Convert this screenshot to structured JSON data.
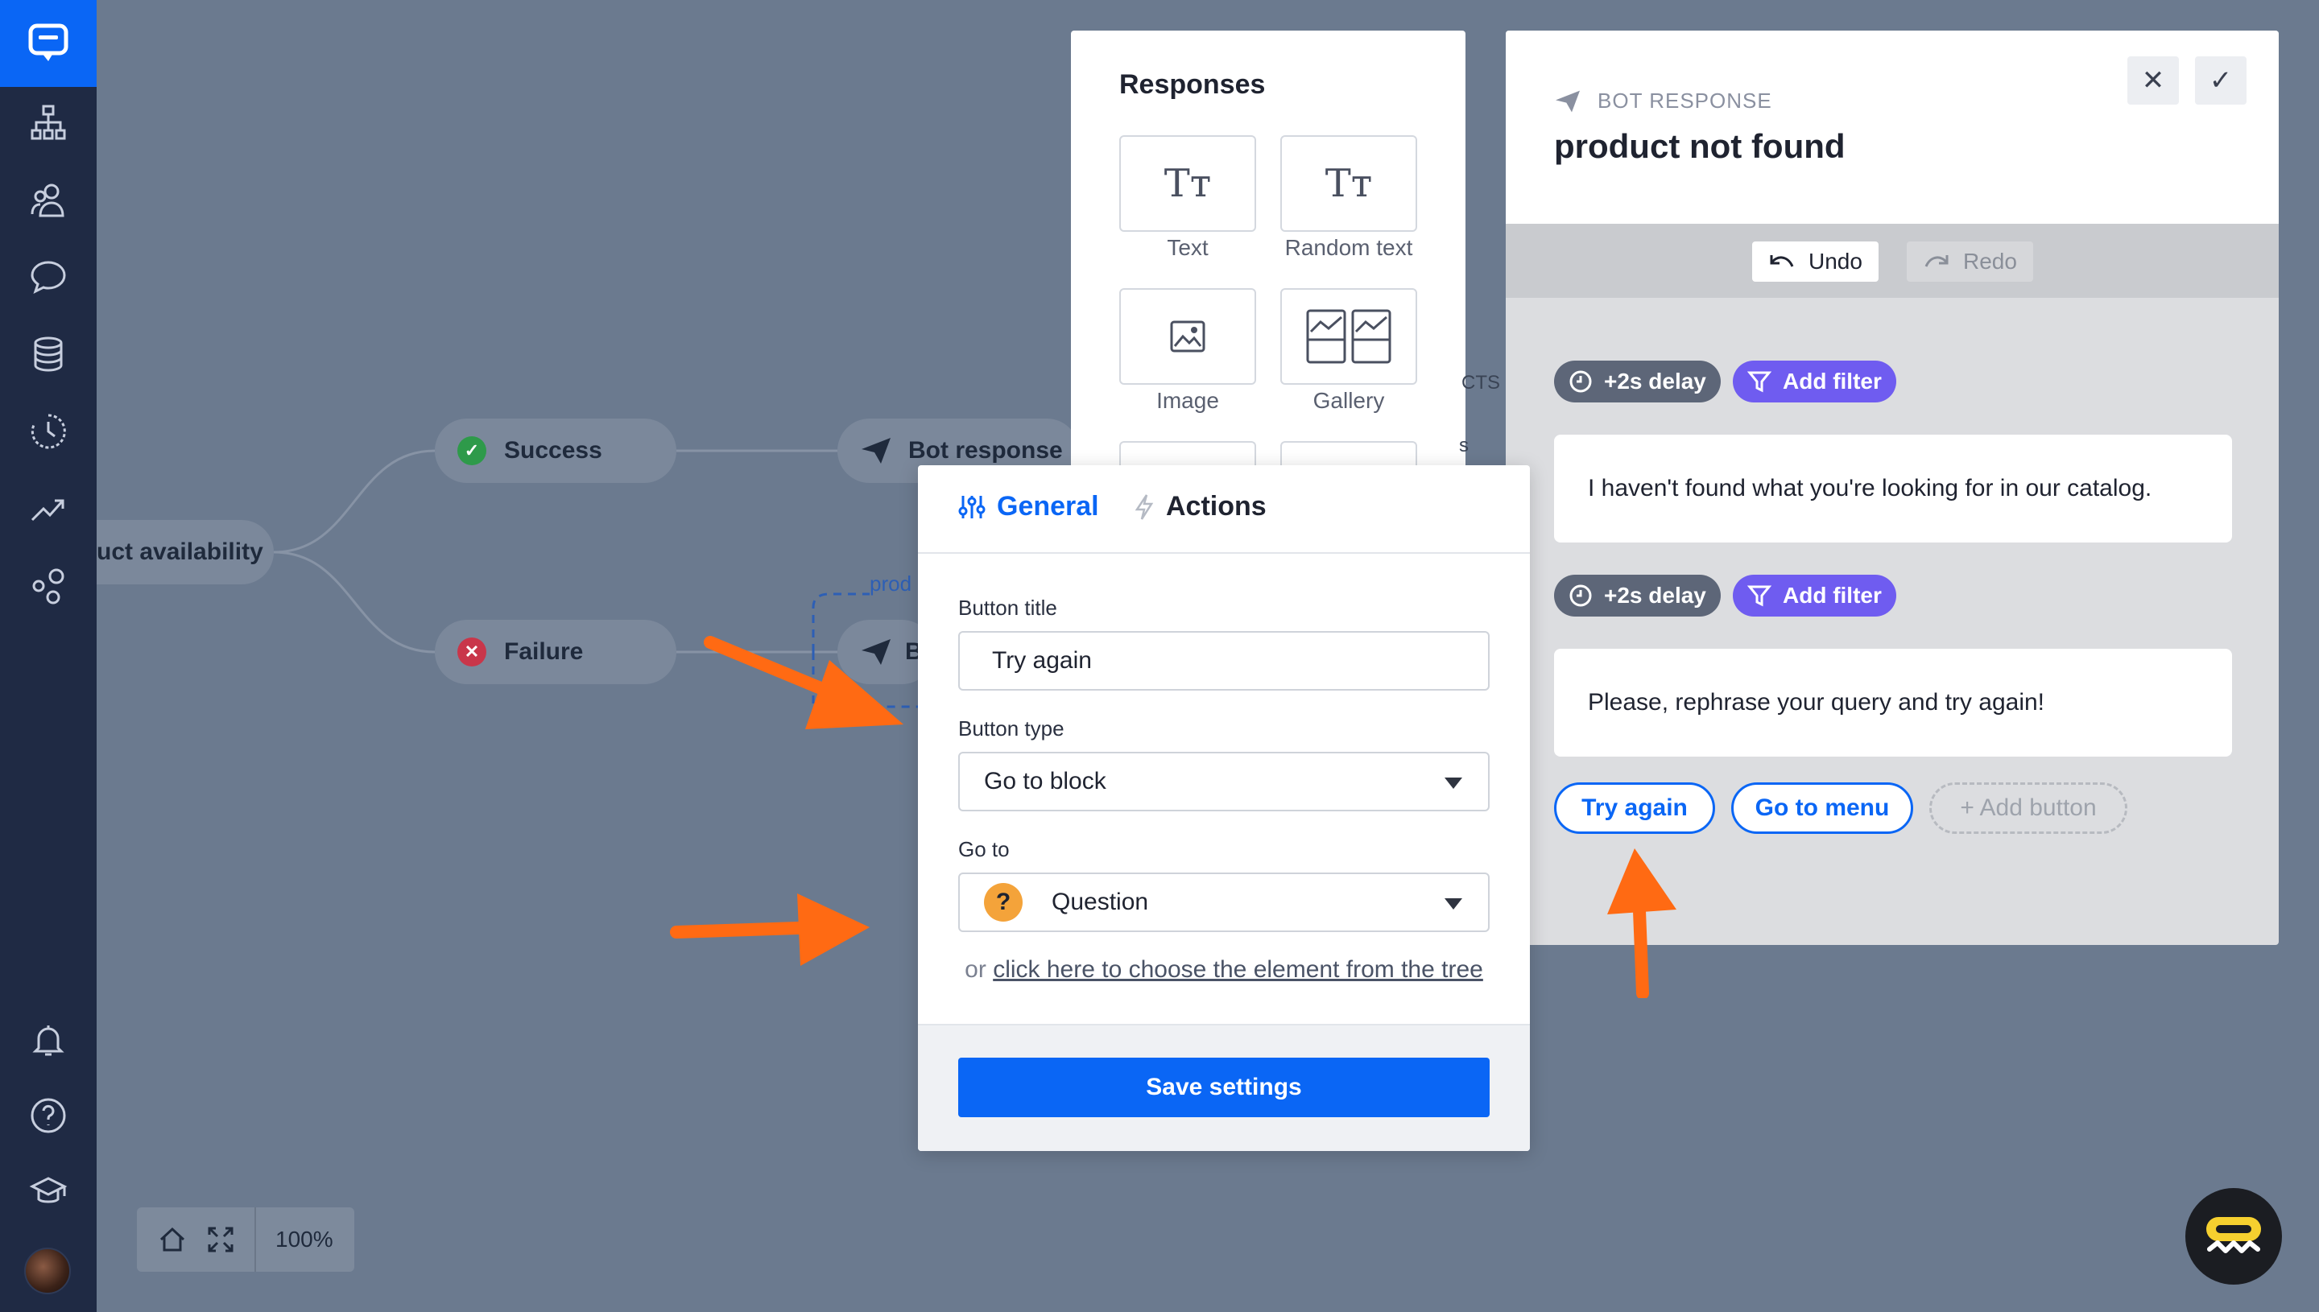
{
  "canvas": {
    "nodes": {
      "product_availability": "uct availability",
      "success": "Success",
      "failure": "Failure",
      "bot_response": "Bot response",
      "bot_response_partial": "B",
      "edge_label": "prod"
    },
    "zoom": "100%"
  },
  "responses": {
    "title": "Responses",
    "items": [
      {
        "label": "Text",
        "icon": "text-format-icon"
      },
      {
        "label": "Random text",
        "icon": "text-format-icon"
      },
      {
        "label": "Image",
        "icon": "image-icon"
      },
      {
        "label": "Gallery",
        "icon": "gallery-icon"
      }
    ],
    "side_text_1": "CTS",
    "side_text_2": "s"
  },
  "editor": {
    "eyebrow": "BOT RESPONSE",
    "title": "product not found",
    "undo": "Undo",
    "redo": "Redo",
    "blocks": [
      {
        "delay": "+2s delay",
        "filter": "Add filter",
        "message": "I haven't found what you're looking for in our catalog."
      },
      {
        "delay": "+2s delay",
        "filter": "Add filter",
        "message": "Please, rephrase your query and try again!"
      }
    ],
    "buttons": {
      "try_again": "Try again",
      "go_to_menu": "Go to menu",
      "add_button": "+ Add button"
    }
  },
  "popup": {
    "tabs": {
      "general": "General",
      "actions": "Actions"
    },
    "button_title_label": "Button title",
    "button_title_value": "Try again",
    "button_type_label": "Button type",
    "button_type_value": "Go to block",
    "go_to_label": "Go to",
    "go_to_value": "Question",
    "hint_prefix": "or",
    "hint_link": "click here to choose the element from the tree",
    "save": "Save settings"
  },
  "colors": {
    "accent": "#0a66f5",
    "filter_pill": "#6f5cf0",
    "delay_pill": "#5d6678",
    "annotation_arrow": "#ff6a13",
    "sidebar": "#1f2a44"
  }
}
